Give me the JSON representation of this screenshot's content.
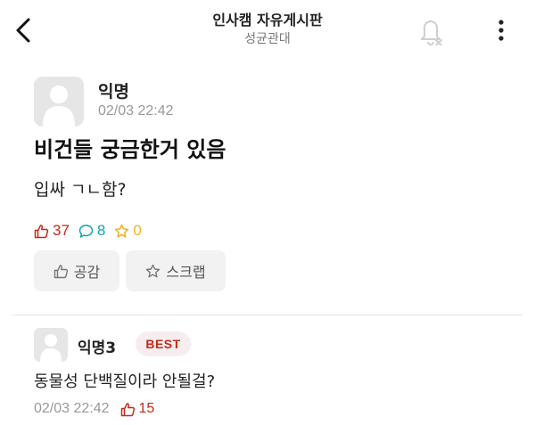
{
  "header": {
    "board_title": "인사캠 자유게시판",
    "school_name": "성균관대",
    "back_icon": "chevron-left-icon",
    "bell_icon": "bell-off-icon",
    "more_icon": "more-vertical-icon"
  },
  "post": {
    "author": "익명",
    "time": "02/03 22:42",
    "title": "비건들 궁금한거 있음",
    "body": "입싸 ㄱㄴ함?",
    "stats": {
      "likes": "37",
      "comments": "8",
      "scraps": "0"
    },
    "actions": {
      "like_label": "공감",
      "scrap_label": "스크랩"
    }
  },
  "comments": [
    {
      "author": "익명3",
      "badge": "BEST",
      "body": "동물성 단백질이라 안될걸?",
      "time": "02/03 22:42",
      "likes": "15"
    }
  ],
  "colors": {
    "like": "#c62917",
    "comment": "#0ca5af",
    "scrap": "#f2b21f"
  }
}
